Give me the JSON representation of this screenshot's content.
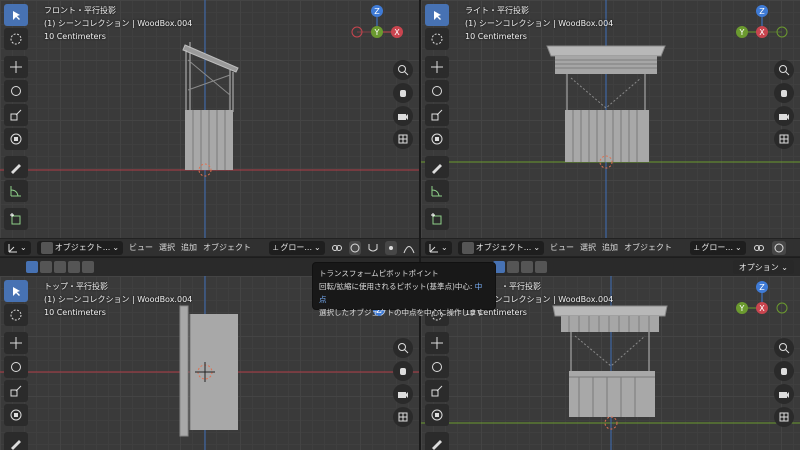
{
  "views": {
    "tl": {
      "name": "フロント・平行投影",
      "collection": "(1) シーンコレクション | WoodBox.004",
      "scale": "10 Centimeters"
    },
    "tr": {
      "name": "ライト・平行投影",
      "collection": "(1) シーンコレクション | WoodBox.004",
      "scale": "10 Centimeters"
    },
    "bl": {
      "name": "トップ・平行投影",
      "collection": "(1) シーンコレクション | WoodBox.004",
      "scale": "10 Centimeters"
    },
    "br": {
      "name": "・平行投影",
      "collection": "(1) シーンコレクション | WoodBox.004",
      "scale": "10 Centimeters"
    }
  },
  "header": {
    "mode": "オブジェクト...",
    "menu_view": "ビュー",
    "menu_select": "選択",
    "menu_add": "追加",
    "menu_object": "オブジェクト",
    "orientation": "グロー..."
  },
  "options_label": "オプション",
  "gizmo_labels": {
    "x": "X",
    "y": "Y",
    "z": "Z"
  },
  "tooltip": {
    "title": "トランスフォームピボットポイント",
    "line1": "回転/拡縮に使用されるピボット(基準点)中心:",
    "line1_value": "中点",
    "line2": "選択したオブジェクトの中点を中心に操作します"
  },
  "colors": {
    "x_axis": "#c9454f",
    "y_axis": "#6b9a2f",
    "z_axis": "#3f7bd6",
    "active": "#4772b3"
  }
}
